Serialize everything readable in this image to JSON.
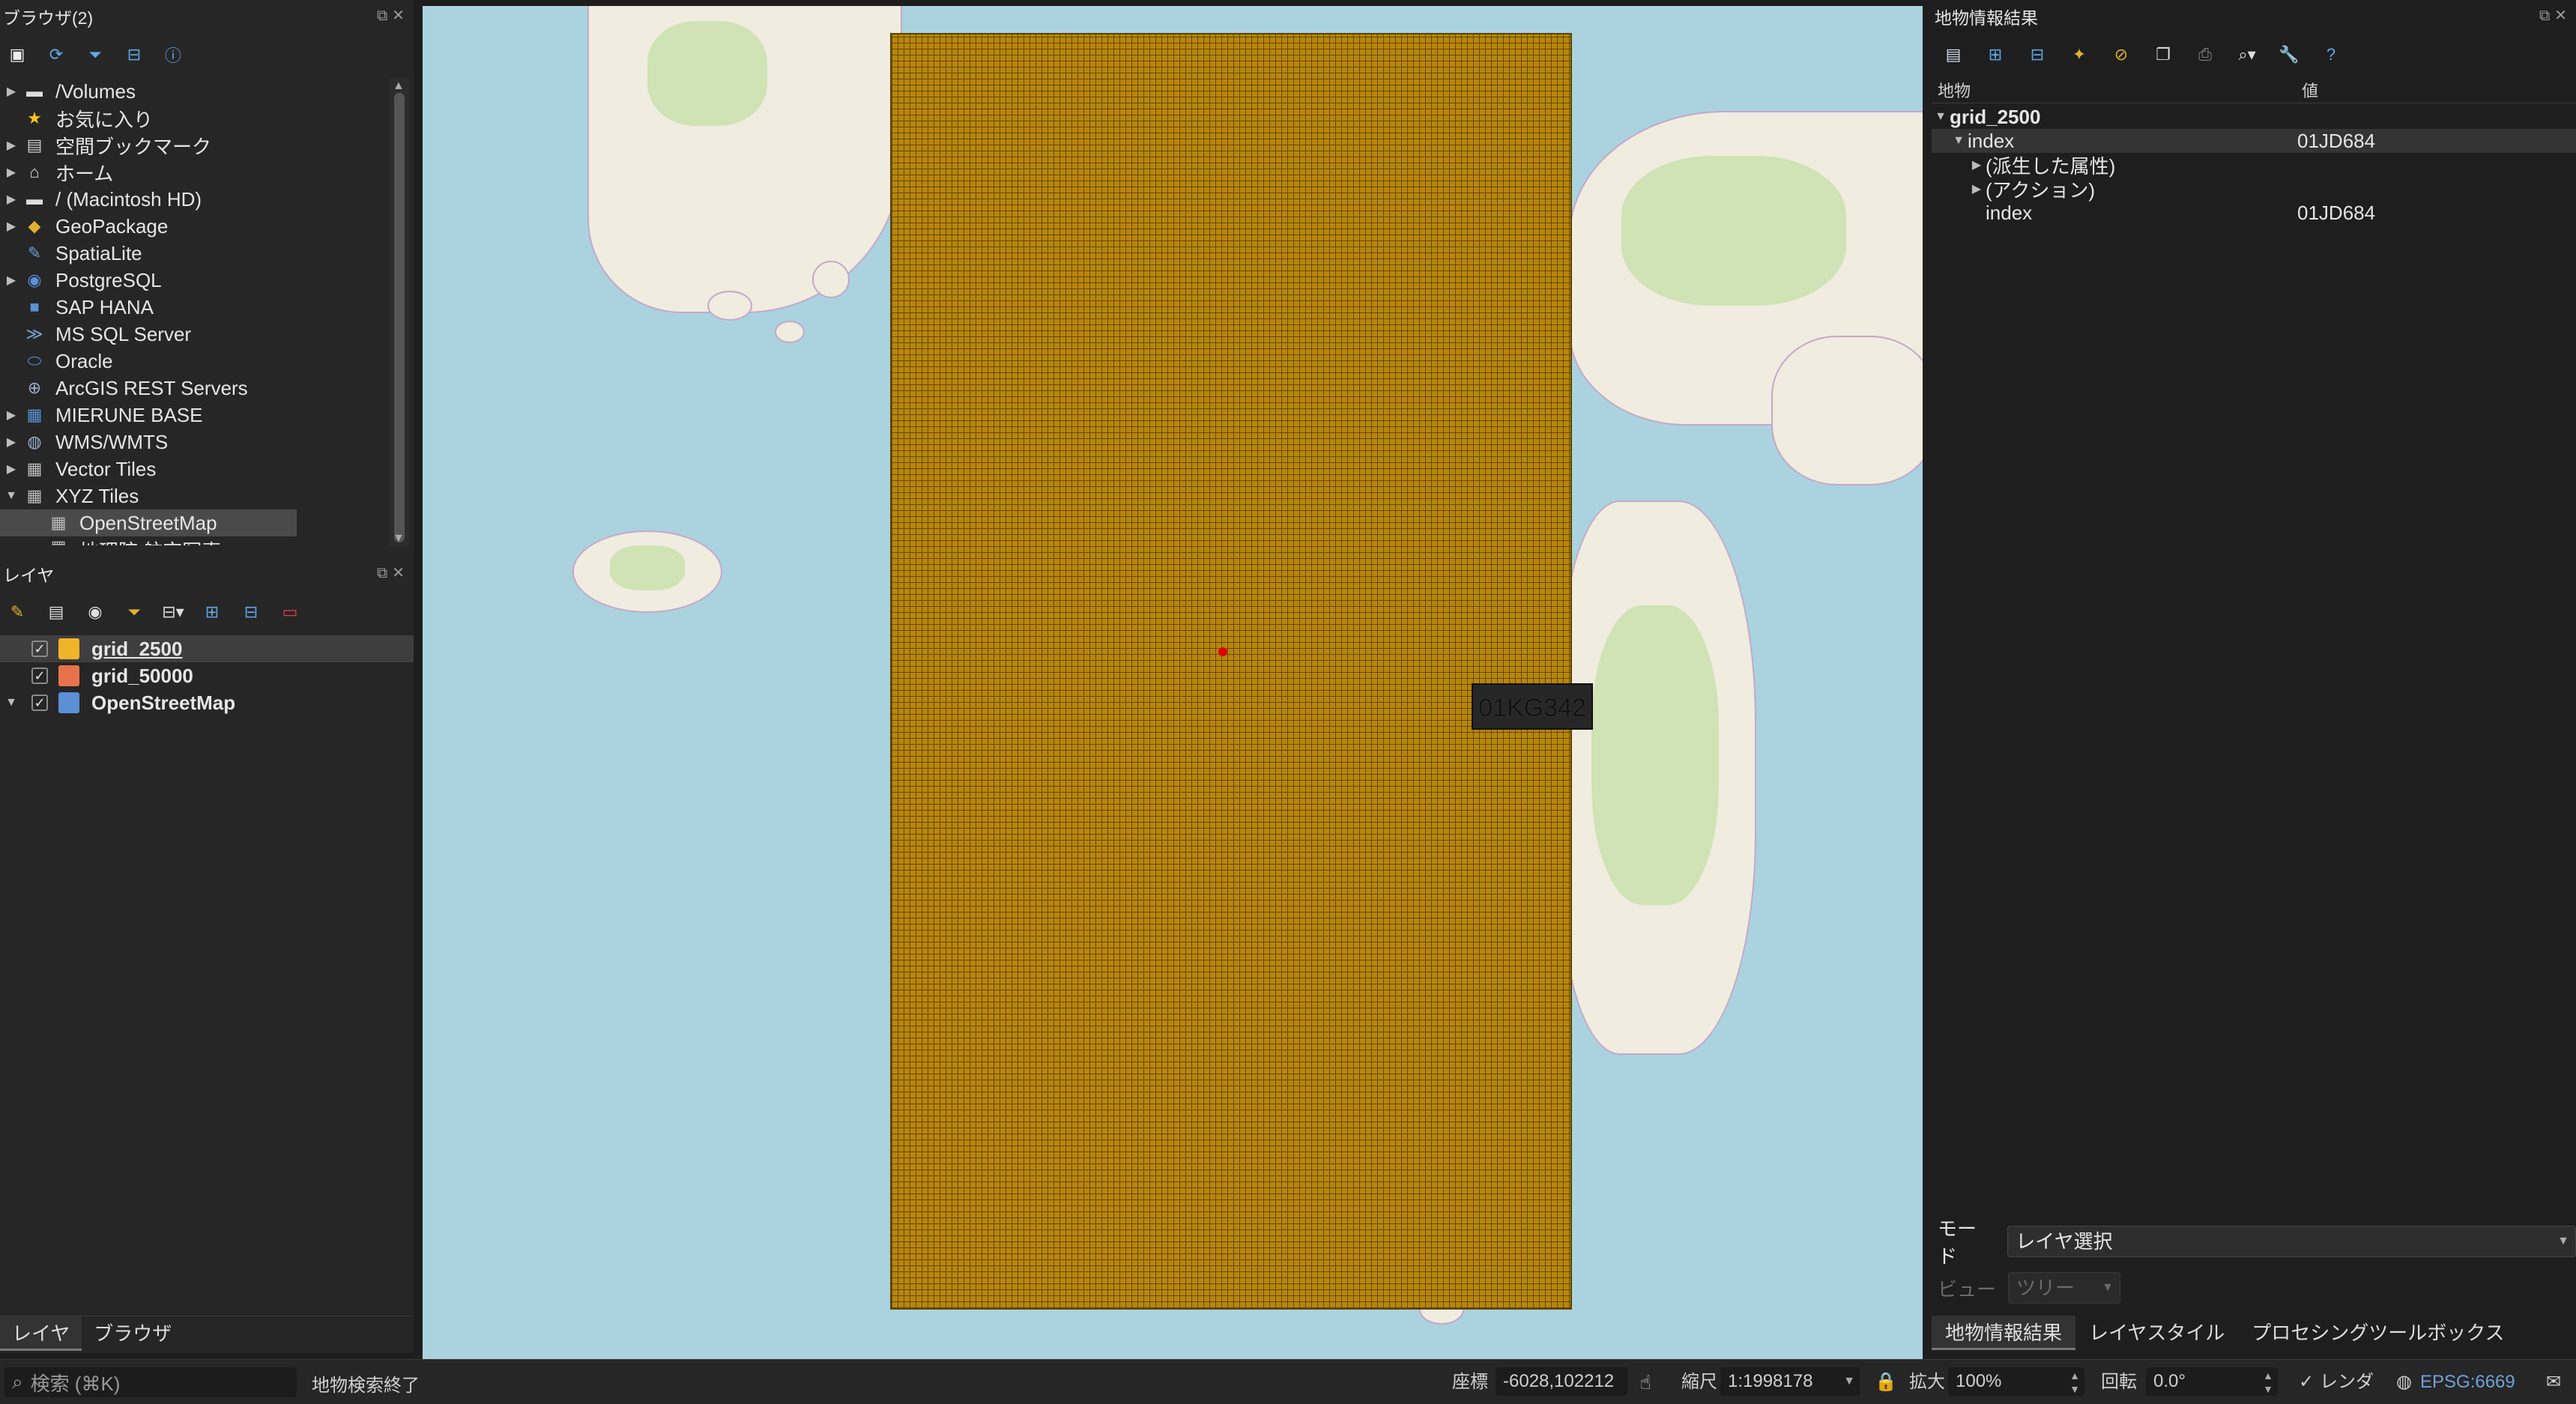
{
  "browser_panel": {
    "title": "ブラウザ(2)",
    "items": [
      {
        "label": "/Volumes",
        "icon": "folder-icon"
      },
      {
        "label": "お気に入り",
        "icon": "star-icon"
      },
      {
        "label": "空間ブックマーク",
        "icon": "bookmark-icon"
      },
      {
        "label": "ホーム",
        "icon": "home-icon"
      },
      {
        "label": "/ (Macintosh HD)",
        "icon": "folder-icon"
      },
      {
        "label": "GeoPackage",
        "icon": "geopackage-icon"
      },
      {
        "label": "SpatiaLite",
        "icon": "spatialite-icon"
      },
      {
        "label": "PostgreSQL",
        "icon": "postgresql-icon"
      },
      {
        "label": "SAP HANA",
        "icon": "database-icon"
      },
      {
        "label": "MS SQL Server",
        "icon": "mssql-icon"
      },
      {
        "label": "Oracle",
        "icon": "oracle-icon"
      },
      {
        "label": "ArcGIS REST Servers",
        "icon": "arcgis-icon"
      },
      {
        "label": "MIERUNE BASE",
        "icon": "database-icon"
      },
      {
        "label": "WMS/WMTS",
        "icon": "globe-icon"
      },
      {
        "label": "Vector Tiles",
        "icon": "grid-icon"
      },
      {
        "label": "XYZ Tiles",
        "icon": "grid-icon"
      },
      {
        "label": "OpenStreetMap",
        "icon": "grid-icon"
      },
      {
        "label": "地理院 航空写真",
        "icon": "grid-icon"
      }
    ]
  },
  "layers_panel": {
    "title": "レイヤ",
    "layers": [
      {
        "name": "grid_2500",
        "checked": "✓",
        "color": "#f0b429"
      },
      {
        "name": "grid_50000",
        "checked": "✓",
        "color": "#e8734a"
      },
      {
        "name": "OpenStreetMap",
        "checked": "✓",
        "color": "#5b8fd6"
      }
    ]
  },
  "left_tabs": {
    "layers": "レイヤ",
    "browser": "ブラウザ"
  },
  "map": {
    "label": "01KG342"
  },
  "identify_panel": {
    "title": "地物情報結果",
    "col_feature": "地物",
    "col_value": "値",
    "rows": [
      {
        "label": "grid_2500",
        "value": ""
      },
      {
        "label": "index",
        "value": "01JD684"
      },
      {
        "label": "(派生した属性)",
        "value": ""
      },
      {
        "label": "(アクション)",
        "value": ""
      },
      {
        "label": "index",
        "value": "01JD684"
      }
    ],
    "mode_label": "モード",
    "mode_value": "レイヤ選択",
    "view_label": "ビュー",
    "view_value": "ツリー"
  },
  "right_tabs": {
    "identify": "地物情報結果",
    "layer_style": "レイヤスタイル",
    "processing": "プロセシングツールボックス"
  },
  "status_bar": {
    "search_placeholder": "検索 (⌘K)",
    "message": "地物検索終了",
    "coord_label": "座標",
    "coord_value": "-6028,102212",
    "scale_label": "縮尺",
    "scale_value": "1:1998178",
    "magnifier_label": "拡大",
    "magnifier_value": "100%",
    "rotation_label": "回転",
    "rotation_value": "0.0°",
    "render_label": "レンダ",
    "crs": "EPSG:6669"
  },
  "colors": {
    "grid_fill": "#b8860b",
    "sea": "#aad3df",
    "land": "#f0ecdf"
  }
}
